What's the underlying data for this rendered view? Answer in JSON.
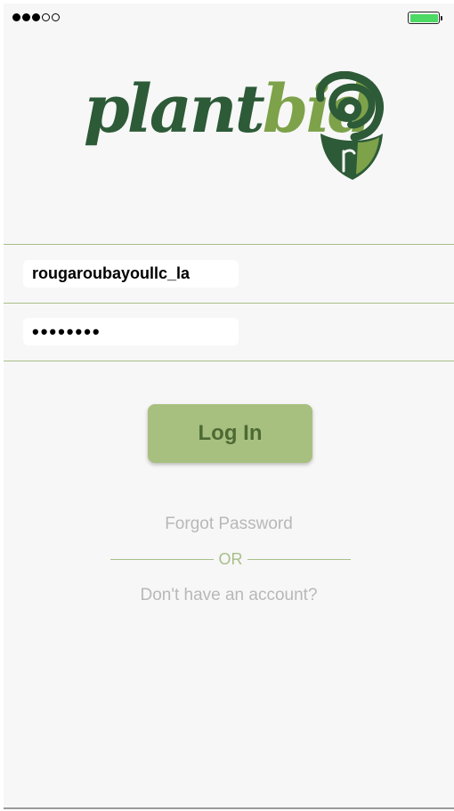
{
  "status_bar": {
    "signal": {
      "filled_dots": 3,
      "total_dots": 5
    },
    "battery": {
      "level": 1.0,
      "color": "#4cd964"
    }
  },
  "logo": {
    "word_part1": "plant",
    "word_part2": "bid",
    "colors": {
      "dark_green": "#2d5a37",
      "light_green": "#7da24a"
    },
    "icon": "rose-shield-icon"
  },
  "form": {
    "username_value": "rougaroubayoullc_la",
    "password_value": "••••••••",
    "divider_color": "#a8be88"
  },
  "login_button": {
    "label": "Log In",
    "color": "#a8c07f"
  },
  "links": {
    "forgot_password": "Forgot Password",
    "or": "OR",
    "signup": "Don't have an account?"
  }
}
